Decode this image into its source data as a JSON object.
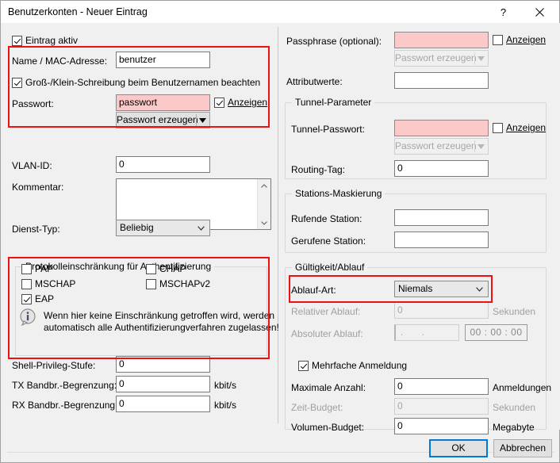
{
  "window": {
    "title": "Benutzerkonten - Neuer Eintrag",
    "help_icon": "help-icon",
    "close_icon": "close-icon"
  },
  "colors": {
    "accent": "#0078d7",
    "highlight": "#ee1111",
    "required_field": "#fcc9c9",
    "dialog_bg": "#f0f0f0"
  },
  "left": {
    "entry_active": {
      "label": "Eintrag aktiv",
      "checked": true
    },
    "name_label": "Name / MAC-Adresse:",
    "name_value": "benutzer",
    "case_sensitive": {
      "label": "Groß-/Klein-Schreibung beim Benutzernamen beachten",
      "checked": true
    },
    "password_label": "Passwort:",
    "password_value": "passwort",
    "password_show": {
      "label": "Anzeigen",
      "checked": true
    },
    "generate_password": "Passwort erzeugen",
    "vlan_label": "VLAN-ID:",
    "vlan_value": "0",
    "comment_label": "Kommentar:",
    "comment_value": "",
    "service_label": "Dienst-Typ:",
    "service_value": "Beliebig",
    "protocol_group": "Protokolleinschränkung für Authentifizierung",
    "protocols": [
      {
        "label": "PAP",
        "checked": false
      },
      {
        "label": "CHAP",
        "checked": false
      },
      {
        "label": "MSCHAP",
        "checked": false
      },
      {
        "label": "MSCHAPv2",
        "checked": false
      },
      {
        "label": "EAP",
        "checked": true
      }
    ],
    "info_line1": "Wenn hier keine Einschränkung getroffen wird, werden",
    "info_line2": "automatisch alle Authentifizierungverfahren zugelassen!",
    "shell_label": "Shell-Privileg-Stufe:",
    "shell_value": "0",
    "tx_label": "TX Bandbr.-Begrenzung:",
    "tx_value": "0",
    "tx_unit": "kbit/s",
    "rx_label": "RX Bandbr.-Begrenzung:",
    "rx_value": "0",
    "rx_unit": "kbit/s"
  },
  "right": {
    "passphrase_label": "Passphrase (optional):",
    "passphrase_value": "",
    "passphrase_show": {
      "label": "Anzeigen",
      "checked": false
    },
    "generate_password": "Passwort erzeugen",
    "attributes_label": "Attributwerte:",
    "attributes_value": "",
    "tunnel_group": "Tunnel-Parameter",
    "tunnel_password_label": "Tunnel-Passwort:",
    "tunnel_password_value": "",
    "tunnel_show": {
      "label": "Anzeigen",
      "checked": false
    },
    "tunnel_generate_password": "Passwort erzeugen",
    "routing_tag_label": "Routing-Tag:",
    "routing_tag_value": "0",
    "station_group": "Stations-Maskierung",
    "calling_label": "Rufende Station:",
    "calling_value": "",
    "called_label": "Gerufene Station:",
    "called_value": "",
    "validity_group": "Gültigkeit/Ablauf",
    "expiry_type_label": "Ablauf-Art:",
    "expiry_type_value": "Niemals",
    "relative_label": "Relativer Ablauf:",
    "relative_value": "0",
    "relative_unit": "Sekunden",
    "absolute_label": "Absoluter Ablauf:",
    "absolute_date": ".  .",
    "absolute_time": "00 : 00 : 00",
    "multi_login": {
      "label": "Mehrfache Anmeldung",
      "checked": true
    },
    "max_count_label": "Maximale Anzahl:",
    "max_count_value": "0",
    "max_count_unit": "Anmeldungen",
    "time_budget_label": "Zeit-Budget:",
    "time_budget_value": "0",
    "time_budget_unit": "Sekunden",
    "volume_budget_label": "Volumen-Budget:",
    "volume_budget_value": "0",
    "volume_budget_unit": "Megabyte"
  },
  "footer": {
    "ok": "OK",
    "cancel": "Abbrechen"
  }
}
